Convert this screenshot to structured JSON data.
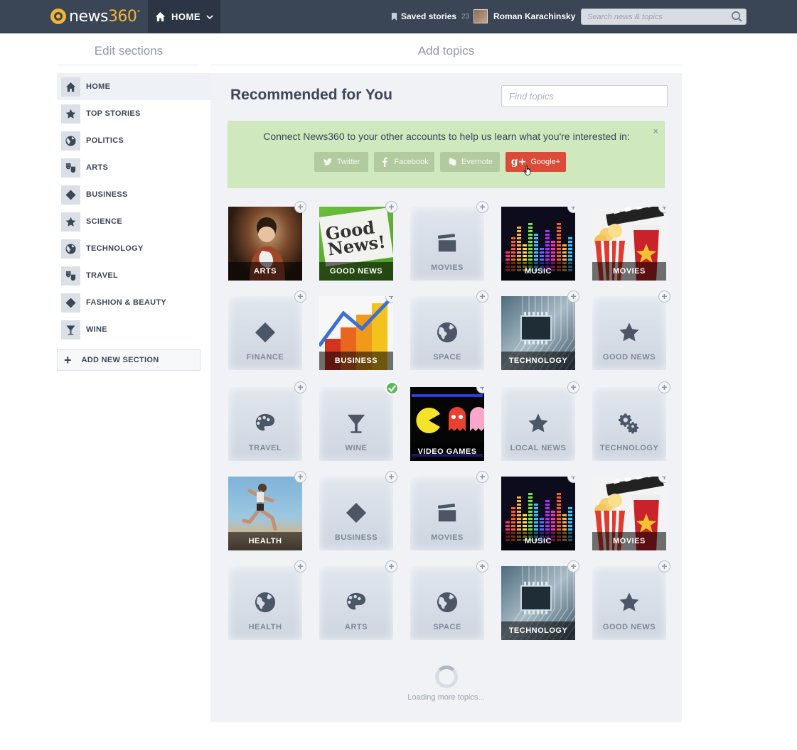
{
  "header": {
    "logo_text": "news",
    "logo_number": "360",
    "logo_degree": "°",
    "home_label": "HOME",
    "saved_label": "Saved stories",
    "saved_count": "23",
    "user_name": "Roman Karachinsky",
    "search_placeholder": "Search news & topics"
  },
  "sidebar": {
    "heading": "Edit sections",
    "items": [
      {
        "label": "HOME",
        "icon": "home-icon"
      },
      {
        "label": "TOP STORIES",
        "icon": "star-icon"
      },
      {
        "label": "POLITICS",
        "icon": "globe-icon"
      },
      {
        "label": "ARTS",
        "icon": "theater-masks-icon"
      },
      {
        "label": "BUSINESS",
        "icon": "money-icon"
      },
      {
        "label": "SCIENCE",
        "icon": "star-icon"
      },
      {
        "label": "TECHNOLOGY",
        "icon": "globe-icon"
      },
      {
        "label": "TRAVEL",
        "icon": "theater-masks-icon"
      },
      {
        "label": "FASHION & BEAUTY",
        "icon": "money-icon"
      },
      {
        "label": "WINE",
        "icon": "cocktail-icon"
      }
    ],
    "add_label": "ADD NEW SECTION"
  },
  "main": {
    "heading": "Add topics",
    "title": "Recommended for You",
    "find_placeholder": "Find topics",
    "connect_text": "Connect News360 to your other accounts to help us learn what you're interested in:",
    "close_glyph": "×",
    "social": {
      "twitter": "Twitter",
      "facebook": "Facebook",
      "evernote": "Evernote",
      "google_glyph": "g+",
      "google": "Google+"
    },
    "tiles": [
      {
        "label": "ARTS",
        "kind": "photo-arts"
      },
      {
        "label": "GOOD NEWS",
        "kind": "photo-goodnews",
        "paper_text": "Good News!"
      },
      {
        "label": "MOVIES",
        "kind": "icon",
        "icon": "clapperboard-icon"
      },
      {
        "label": "MUSIC",
        "kind": "photo-music"
      },
      {
        "label": "MOVIES",
        "kind": "photo-movies"
      },
      {
        "label": "FINANCE",
        "kind": "icon",
        "icon": "money-icon"
      },
      {
        "label": "BUSINESS",
        "kind": "photo-business"
      },
      {
        "label": "SPACE",
        "kind": "icon",
        "icon": "globe-icon"
      },
      {
        "label": "TECHNOLOGY",
        "kind": "photo-tech"
      },
      {
        "label": "GOOD NEWS",
        "kind": "icon",
        "icon": "star-icon"
      },
      {
        "label": "TRAVEL",
        "kind": "icon",
        "icon": "palette-icon"
      },
      {
        "label": "WINE",
        "kind": "icon",
        "icon": "cocktail-icon",
        "selected": true
      },
      {
        "label": "VIDEO GAMES",
        "kind": "photo-games"
      },
      {
        "label": "LOCAL NEWS",
        "kind": "icon",
        "icon": "star-icon"
      },
      {
        "label": "TECHNOLOGY",
        "kind": "icon",
        "icon": "gears-icon"
      },
      {
        "label": "HEALTH",
        "kind": "photo-health"
      },
      {
        "label": "BUSINESS",
        "kind": "icon",
        "icon": "money-icon"
      },
      {
        "label": "MOVIES",
        "kind": "icon",
        "icon": "clapperboard-icon"
      },
      {
        "label": "MUSIC",
        "kind": "photo-music"
      },
      {
        "label": "MOVIES",
        "kind": "photo-movies"
      },
      {
        "label": "HEALTH",
        "kind": "icon",
        "icon": "globe-icon"
      },
      {
        "label": "ARTS",
        "kind": "icon",
        "icon": "palette-icon"
      },
      {
        "label": "SPACE",
        "kind": "icon",
        "icon": "globe-icon"
      },
      {
        "label": "TECHNOLOGY",
        "kind": "photo-tech"
      },
      {
        "label": "GOOD NEWS",
        "kind": "icon",
        "icon": "star-icon"
      }
    ],
    "add_glyph": "+",
    "loading_text": "Loading more topics..."
  },
  "colors": {
    "topbar": "#3a4555",
    "accent_yellow": "#f2b632",
    "connect_bg": "#cfe8be",
    "google_red": "#dc4a38",
    "selected_green": "#5cb85c"
  }
}
